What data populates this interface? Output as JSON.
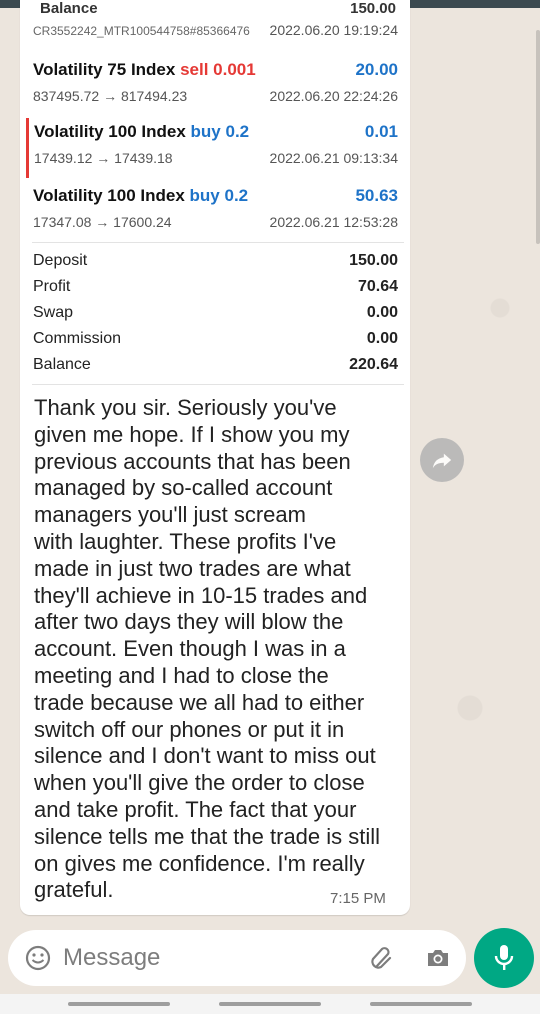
{
  "quoted_report": {
    "cut_row": {
      "label": "Balance",
      "value": "150.00"
    },
    "account_id": "CR3552242_MTR100544758#85366476",
    "account_time": "2022.06.20 19:19:24",
    "trades": [
      {
        "symbol": "Volatility 75 Index",
        "side": "sell",
        "volume": "0.001",
        "profit": "20.00",
        "prices": "837495.72 → 817494.23",
        "time": "2022.06.20 22:24:26"
      },
      {
        "symbol": "Volatility 100 Index",
        "side": "buy",
        "volume": "0.2",
        "profit": "0.01",
        "prices": "17439.12 → 17439.18",
        "time": "2022.06.21 09:13:34"
      },
      {
        "symbol": "Volatility 100 Index",
        "side": "buy",
        "volume": "0.2",
        "profit": "50.63",
        "prices": "17347.08 → 17600.24",
        "time": "2022.06.21 12:53:28"
      }
    ],
    "summary": [
      {
        "label": "Deposit",
        "value": "150.00"
      },
      {
        "label": "Profit",
        "value": "70.64"
      },
      {
        "label": "Swap",
        "value": "0.00"
      },
      {
        "label": "Commission",
        "value": "0.00"
      },
      {
        "label": "Balance",
        "value": "220.64"
      }
    ]
  },
  "message": {
    "text": "Thank you sir. Seriously you've\ngiven me hope. If I show you my\nprevious accounts that has been\nmanaged by so-called account\nmanagers you'll just scream\nwith laughter. These profits I've\nmade in just two trades are what\nthey'll achieve in 10-15 trades and\nafter two days they will blow the\naccount. Even though I was in a\nmeeting and I had to close the\ntrade because we all had to either\nswitch off our phones or put it in\nsilence and I don't want to miss out\nwhen you'll give the order to close\nand take profit. The fact that your\nsilence tells me that the trade is still\non gives me confidence. I'm really\ngrateful.",
    "time": "7:15 PM"
  },
  "composer": {
    "placeholder": "Message",
    "icons": [
      "emoji-icon",
      "attach-icon",
      "camera-icon",
      "mic-icon"
    ]
  },
  "colors": {
    "accent_green": "#00a884",
    "sell_red": "#e53935",
    "buy_blue": "#1e73c8",
    "chat_bg": "#ece5dd"
  }
}
